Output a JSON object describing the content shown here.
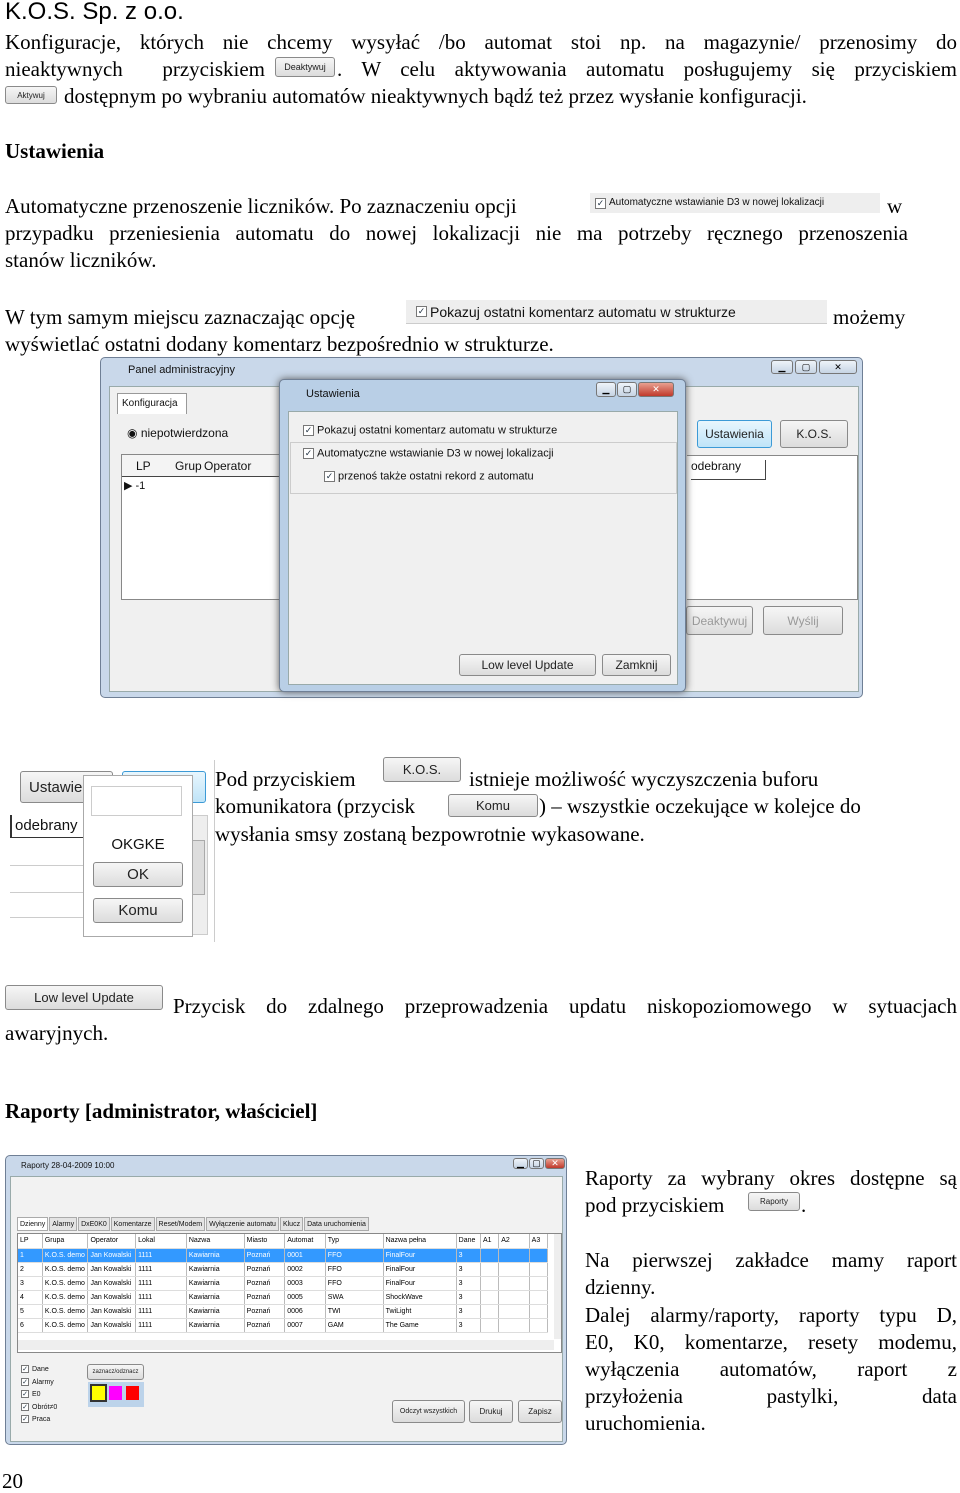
{
  "header": "K.O.S. Sp. z o.o.",
  "p1": {
    "l1": "Konfiguracje, których nie chcemy wysyłać /bo automat stoi np. na magazynie/ przenosimy do",
    "l2a": "nieaktywnych przyciskiem",
    "l2b": ". W celu aktywowania automatu posługujemy się przyciskiem",
    "l3": "dostępnym po wybraniu automatów nieaktywnych bądź też przez wysłanie konfiguracji.",
    "btn_deaktywuj": "Deaktywuj",
    "btn_aktywuj": "Aktywuj"
  },
  "section1": "Ustawienia",
  "p2": {
    "l1a": "Automatyczne przenoszenie liczników. Po zaznaczeniu opcji",
    "l1b": "w",
    "l2": "przypadku przeniesienia automatu do nowej lokalizacji nie ma potrzeby ręcznego przenoszenia",
    "l3": "stanów liczników.",
    "option": "Automatyczne wstawianie D3 w nowej lokalizacji"
  },
  "p3": {
    "l1a": "W tym samym miejscu zaznaczając opcję",
    "l1b": "możemy",
    "l2": "wyświetlać ostatni dodany komentarz bezpośrednio w strukturze.",
    "option": "Pokazuj ostatni komentarz automatu w strukturze"
  },
  "shot1": {
    "title": "Panel administracyjny",
    "tab": "Konfiguracja",
    "radio": "niepotwierdzona",
    "cols": [
      "LP",
      "Grup",
      "Operator"
    ],
    "row": "-1",
    "col_right": "odebrany",
    "btn_ustawienia": "Ustawienia",
    "btn_kos": "K.O.S.",
    "btn_deaktywuj": "Deaktywuj",
    "btn_wyslij": "Wyślij",
    "dialog": {
      "title": "Ustawienia",
      "opt1": "Pokazuj ostatni komentarz automatu w strukturze",
      "opt2": "Automatyczne wstawianie D3 w nowej lokalizacji",
      "opt3": "przenoś także ostatni rekord z automatu",
      "btn_update": "Low level Update",
      "btn_close": "Zamknij",
      "checked": [
        true,
        true,
        true
      ]
    }
  },
  "p4": {
    "l1a": "Pod przyciskiem",
    "l1b": "istnieje możliwość wyczyszczenia buforu",
    "l2a": "komunikatora (przycisk",
    "l2b": ") – wszystkie oczekujące w kolejce do",
    "l3": "wysłania smsy zostaną bezpowrotnie wykasowane.",
    "btn_kos": "K.O.S.",
    "btn_komu": "Komu"
  },
  "shot2": {
    "btn_ustawienia": "Ustawie",
    "col": "odebrany",
    "code": "OKGKE",
    "btn_ok": "OK",
    "btn_komu": "Komu"
  },
  "p5": {
    "btn": "Low level Update",
    "l1": "Przycisk do zdalnego przeprowadzenia updatu niskopoziomowego w sytuacjach",
    "l2": "awaryjnych."
  },
  "section2": "Raporty [administrator, właściciel]",
  "shot3": {
    "title": "Raporty 28-04-2009  10:00",
    "tabs": [
      "Dzienny",
      "Alarmy",
      "DxE0K0",
      "Komentarze",
      "Reset/Modem",
      "Wyłączenie automatu",
      "Klucz",
      "Data uruchomienia"
    ],
    "columns": [
      "LP",
      "Grupa",
      "Operator",
      "Lokal",
      "Nazwa",
      "Miasto",
      "Automat",
      "Typ",
      "Nazwa pełna",
      "Dane",
      "A1",
      "A2",
      "A3"
    ],
    "rows": [
      [
        "1",
        "K.O.S. demo",
        "Jan Kowalski",
        "1111",
        "Kawiarnia",
        "Poznań",
        "0001",
        "FFO",
        "FinalFour",
        "3",
        "",
        "",
        ""
      ],
      [
        "2",
        "K.O.S. demo",
        "Jan Kowalski",
        "1111",
        "Kawiarnia",
        "Poznań",
        "0002",
        "FFO",
        "FinalFour",
        "3",
        "",
        "",
        ""
      ],
      [
        "3",
        "K.O.S. demo",
        "Jan Kowalski",
        "1111",
        "Kawiarnia",
        "Poznań",
        "0003",
        "FFO",
        "FinalFour",
        "3",
        "",
        "",
        ""
      ],
      [
        "4",
        "K.O.S. demo",
        "Jan Kowalski",
        "1111",
        "Kawiarnia",
        "Poznań",
        "0005",
        "SWA",
        "ShockWave",
        "3",
        "",
        "",
        ""
      ],
      [
        "5",
        "K.O.S. demo",
        "Jan Kowalski",
        "1111",
        "Kawiarnia",
        "Poznań",
        "0006",
        "TWI",
        "TwiLight",
        "3",
        "",
        "",
        ""
      ],
      [
        "6",
        "K.O.S. demo",
        "Jan Kowalski",
        "1111",
        "Kawiarnia",
        "Poznań",
        "0007",
        "GAM",
        "The Game",
        "3",
        "",
        "",
        ""
      ]
    ],
    "checks": [
      "Dane",
      "Alarmy",
      "E0",
      "Obrót≠0",
      "Praca"
    ],
    "btn_toggle": "zaznacz/odznacz",
    "colors": [
      "#ffff00",
      "#ff00ff",
      "#ff0000"
    ],
    "btn_read": "Odczyt wszystkich",
    "btn_print": "Drukuj",
    "btn_save": "Zapisz"
  },
  "p6": {
    "l1": "Raporty za wybrany okres dostępne są",
    "l2": "pod przyciskiem",
    "l2b": ".",
    "btn": "Raporty",
    "l3": "Na pierwszej zakładce mamy raport",
    "l4": "dzienny.",
    "l5": "Dalej alarmy/raporty, raporty typu D,",
    "l6": "E0, K0, komentarze, resety modemu,",
    "l7": "wyłączenia automatów, raport z",
    "l8": "przyłożenia pastylki, data",
    "l9": "uruchomienia."
  },
  "page_number": "20"
}
